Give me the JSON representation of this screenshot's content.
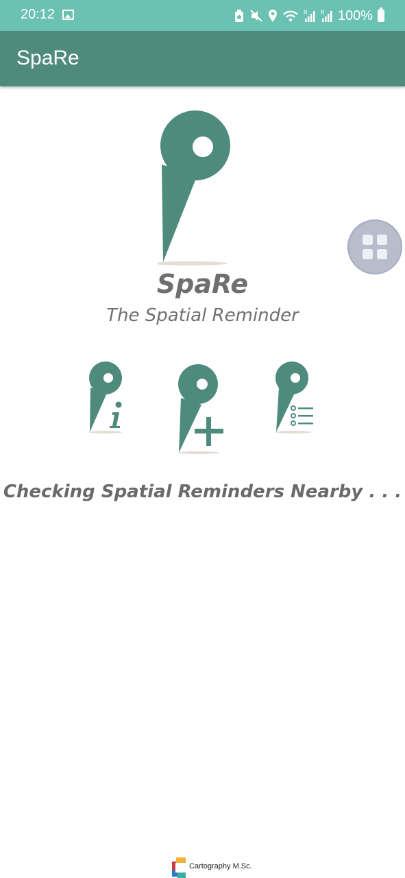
{
  "status_bar": {
    "time": "20:12",
    "battery": "100%"
  },
  "app_bar": {
    "title": "SpaRe"
  },
  "brand": {
    "name": "SpaRe",
    "tagline": "The Spatial Reminder"
  },
  "actions": [
    {
      "icon": "pin-info-icon"
    },
    {
      "icon": "pin-add-icon"
    },
    {
      "icon": "pin-list-icon"
    }
  ],
  "status_message": "Checking Spatial Reminders Nearby . . .",
  "footer": {
    "text": "Cartography M.Sc."
  },
  "colors": {
    "status_bar": "#6bc1b2",
    "app_bar": "#4e8b7d",
    "pin": "#4e8b7d",
    "text_gray": "#6f6f6f"
  }
}
